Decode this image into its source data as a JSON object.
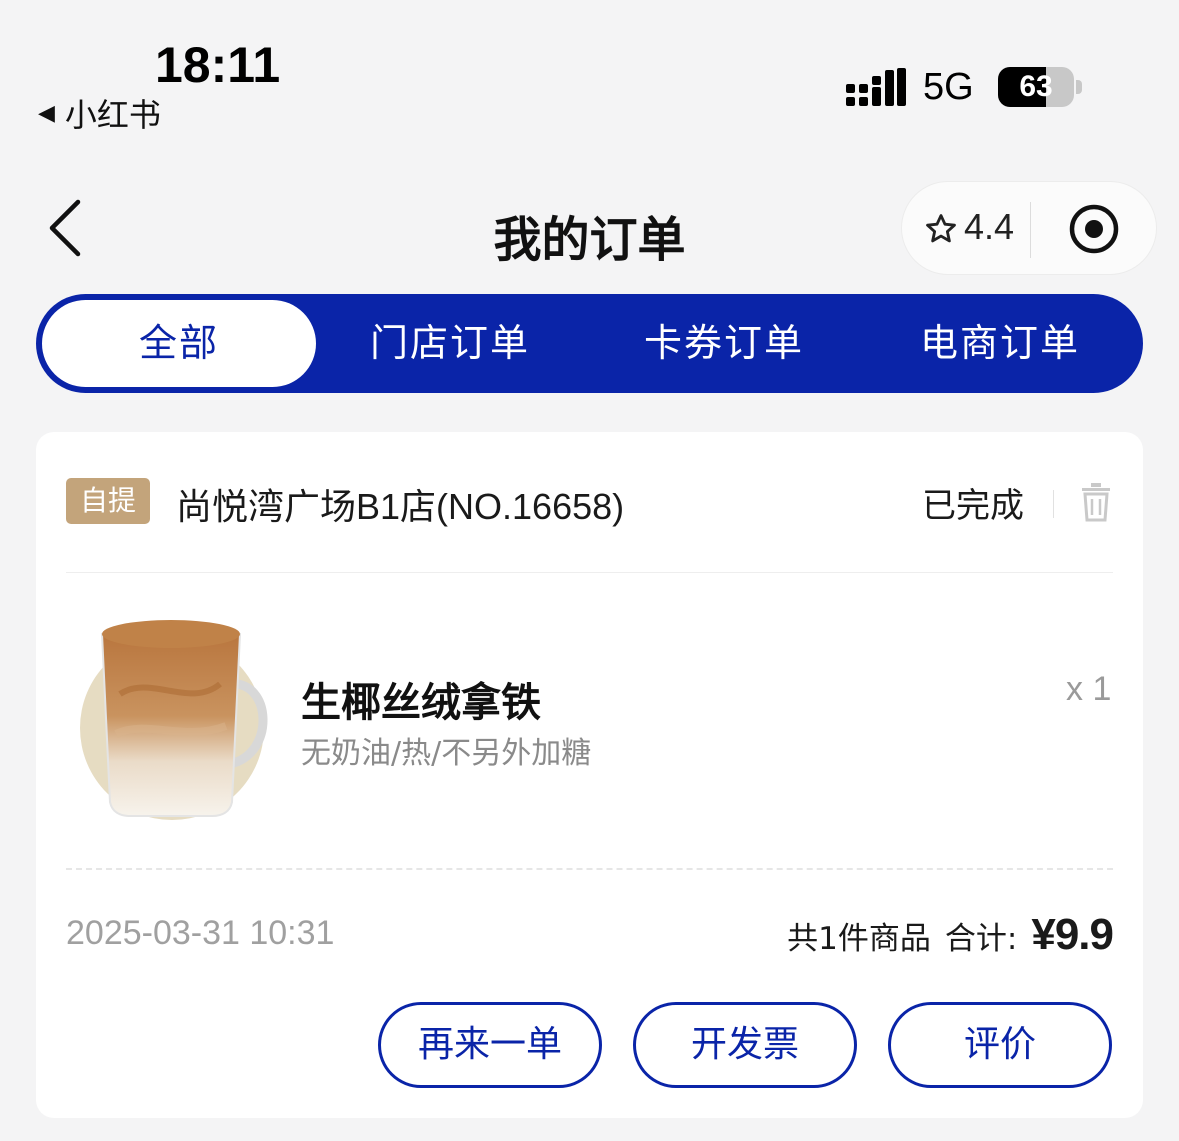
{
  "status_bar": {
    "time": "18:11",
    "back_app": "小红书",
    "network": "5G",
    "battery_level": 63
  },
  "nav": {
    "title": "我的订单",
    "rating": "4.4"
  },
  "tabs": [
    {
      "label": "全部",
      "active": true
    },
    {
      "label": "门店订单",
      "active": false
    },
    {
      "label": "卡券订单",
      "active": false
    },
    {
      "label": "电商订单",
      "active": false
    }
  ],
  "order": {
    "badge": "自提",
    "store": "尚悦湾广场B1店(NO.16658)",
    "status": "已完成",
    "product": {
      "name": "生椰丝绒拿铁",
      "options": "无奶油/热/不另外加糖",
      "quantity": "x 1"
    },
    "time": "2025-03-31 10:31",
    "item_count": "共1件商品",
    "total_label": "合计:",
    "total_price": "¥9.9",
    "actions": [
      "再来一单",
      "开发票",
      "评价"
    ]
  },
  "colors": {
    "brand_blue": "#0a24a8",
    "badge_tan": "#c3a47b",
    "background": "#f4f4f5"
  }
}
